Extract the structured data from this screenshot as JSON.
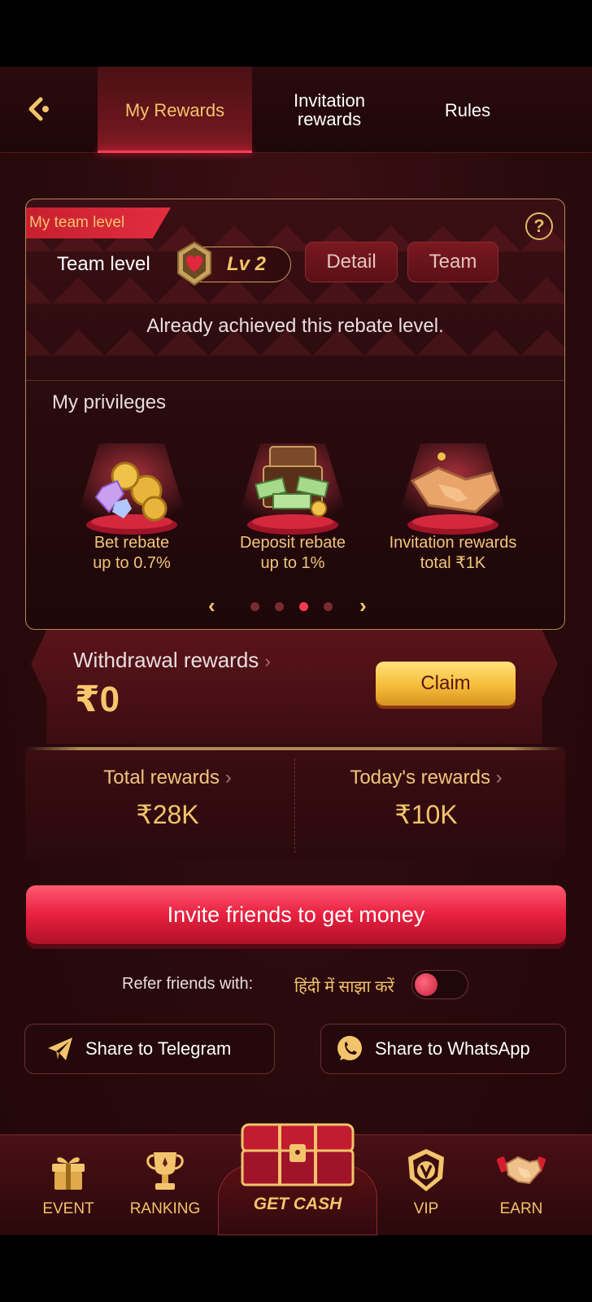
{
  "header": {
    "tabs": [
      {
        "label": "My Rewards"
      },
      {
        "label": "Invitation rewards"
      },
      {
        "label": "Rules"
      }
    ]
  },
  "team": {
    "ribbon": "My team level",
    "team_level_label": "Team level",
    "level": "Lv 2",
    "detail_label": "Detail",
    "team_label": "Team",
    "status": "Already achieved this rebate level."
  },
  "privileges": {
    "title": "My privileges",
    "items": [
      {
        "line1": "Bet rebate",
        "line2": "up to 0.7%"
      },
      {
        "line1": "Deposit rebate",
        "line2": "up to 1%"
      },
      {
        "line1": "Invitation rewards",
        "line2": "total ₹1K"
      }
    ],
    "pager": {
      "total": 4,
      "active": 3
    }
  },
  "withdrawal": {
    "title": "Withdrawal rewards",
    "amount": "₹0",
    "claim_label": "Claim"
  },
  "rewards": {
    "total_label": "Total rewards",
    "total_value": "₹28K",
    "today_label": "Today's rewards",
    "today_value": "₹10K"
  },
  "invite_label": "Invite friends to get money",
  "refer": {
    "label": "Refer friends with:",
    "hindi_label": "हिंदी में साझा करें",
    "toggle_on": false
  },
  "share": {
    "telegram": "Share to Telegram",
    "whatsapp": "Share to WhatsApp"
  },
  "bottom_nav": {
    "event": "EVENT",
    "ranking": "RANKING",
    "get_cash": "GET CASH",
    "vip": "VIP",
    "earn": "EARN"
  },
  "colors": {
    "accent_gold": "#f3c46b",
    "accent_red": "#ff3a55",
    "background": "#2a0a0d"
  }
}
